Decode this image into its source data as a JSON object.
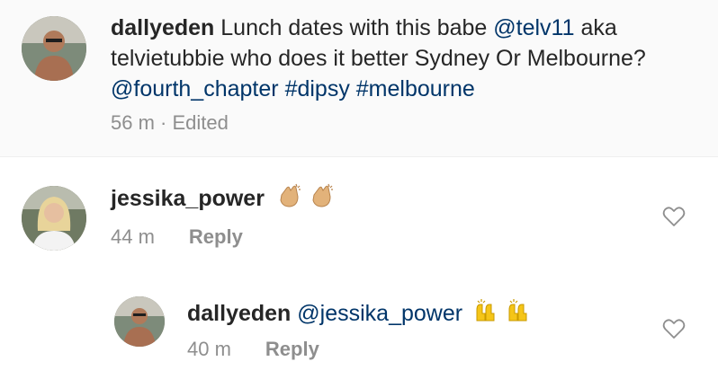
{
  "caption": {
    "username": "dallyeden",
    "text_1": " Lunch dates with this babe ",
    "mention_1": "@telv11",
    "text_2": " aka telvietubbie who does it better Sydney Or Melbourne?",
    "mention_2": "@fourth_chapter",
    "hashtag_1": "#dipsy",
    "hashtag_2": "#melbourne",
    "time": "56 m",
    "separator": " · ",
    "edited": "Edited"
  },
  "comments": [
    {
      "username": "jessika_power",
      "emoji": "clapping-hands-icon",
      "time": "44 m",
      "reply_label": "Reply"
    },
    {
      "username": "dallyeden",
      "mention": "@jessika_power",
      "emoji": "raising-hands-icon",
      "time": "40 m",
      "reply_label": "Reply"
    }
  ],
  "colors": {
    "link": "#003569",
    "meta": "#8e8e8e",
    "text": "#262626",
    "caption_bg": "#fafafa",
    "emoji": "#e2b27a"
  }
}
